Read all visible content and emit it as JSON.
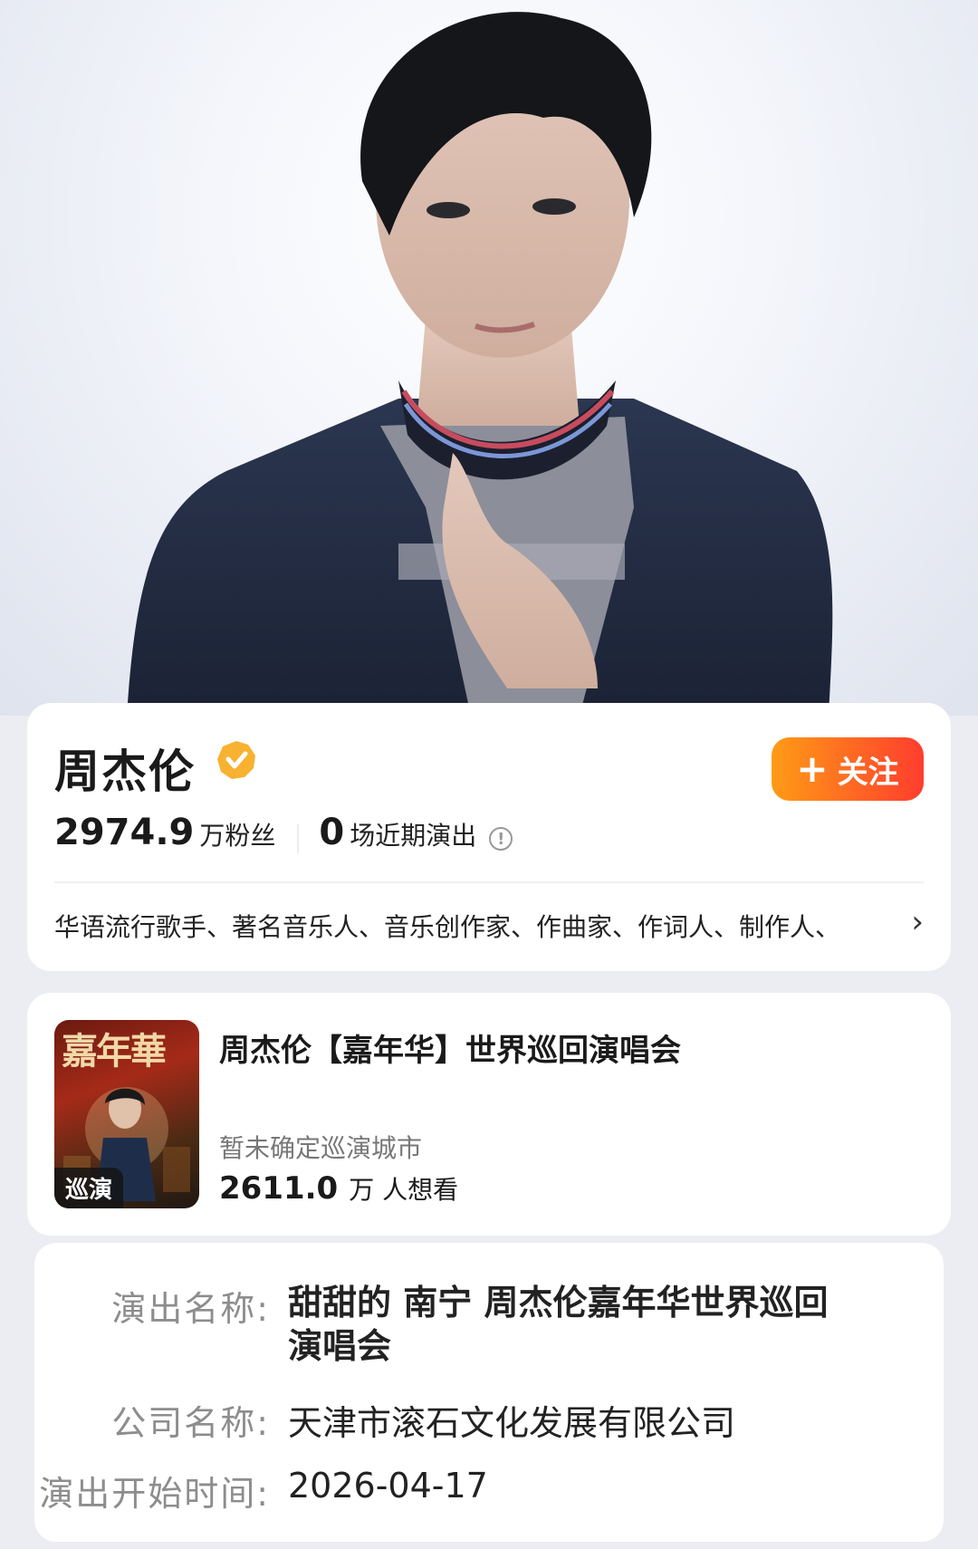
{
  "profile": {
    "name": "周杰伦",
    "fans_count": "2974.9",
    "fans_unit": "万粉丝",
    "shows_count": "0",
    "shows_unit": "场近期演出",
    "tags": "华语流行歌手、著名音乐人、音乐创作家、作曲家、作词人、制作人、",
    "follow_label": "关注",
    "colors": {
      "accent_start": "#ff9b16",
      "accent_end": "#ff3d2e",
      "verified": "#f7b231"
    }
  },
  "concert": {
    "poster_title": "嘉年華",
    "badge": "巡演",
    "title": "周杰伦【嘉年华】世界巡回演唱会",
    "city": "暂未确定巡演城市",
    "want_count": "2611.0",
    "want_unit": "万 人想看"
  },
  "details": {
    "show_name_label": "演出名称:",
    "show_name": "甜甜的 南宁 周杰伦嘉年华世界巡回演唱会",
    "company_label": "公司名称:",
    "company": "天津市滚石文化发展有限公司",
    "start_label": "演出开始时间:",
    "start_date": "2026-04-17"
  }
}
